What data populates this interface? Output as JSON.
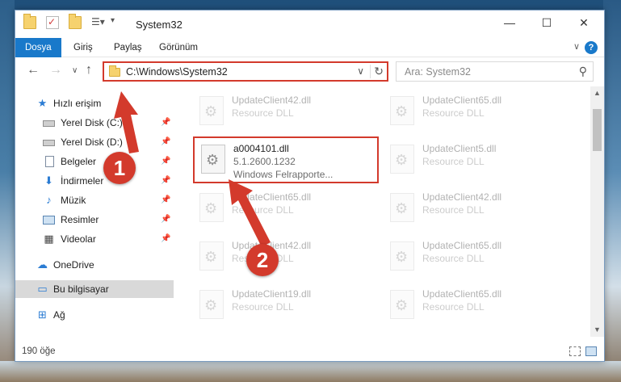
{
  "window": {
    "title": "System32",
    "controls": {
      "minimize": "—",
      "maximize": "☐",
      "close": "✕"
    }
  },
  "ribbon": {
    "tabs": [
      "Dosya",
      "Giriş",
      "Paylaş",
      "Görünüm"
    ],
    "help": "?",
    "collapse": "∨"
  },
  "nav": {
    "back": "←",
    "forward": "→",
    "recent": "∨",
    "up": "↑",
    "address": "C:\\Windows\\System32",
    "address_dropdown": "∨",
    "refresh": "↻",
    "search_placeholder": "Ara: System32",
    "search_icon": "⚲"
  },
  "sidebar": {
    "items": [
      {
        "label": "Hızlı erişim",
        "icon": "star-icon",
        "glyph": "★",
        "color": "#2b7cd3",
        "pinned": false
      },
      {
        "label": "Yerel Disk (C:)",
        "icon": "drive-icon",
        "glyph": "",
        "color": "#8f8f8f",
        "pinned": true
      },
      {
        "label": "Yerel Disk (D:)",
        "icon": "drive-icon",
        "glyph": "",
        "color": "#8f8f8f",
        "pinned": true
      },
      {
        "label": "Belgeler",
        "icon": "documents-icon",
        "glyph": "",
        "color": "#7d8ca0",
        "pinned": true
      },
      {
        "label": "İndirmeler",
        "icon": "download-icon",
        "glyph": "⬇",
        "color": "#2b7cd3",
        "pinned": true
      },
      {
        "label": "Müzik",
        "icon": "music-icon",
        "glyph": "♪",
        "color": "#2b7cd3",
        "pinned": true
      },
      {
        "label": "Resimler",
        "icon": "pictures-icon",
        "glyph": "",
        "color": "#5a86b3",
        "pinned": true
      },
      {
        "label": "Videolar",
        "icon": "videos-icon",
        "glyph": "▦",
        "color": "#444",
        "pinned": true
      },
      {
        "label": "OneDrive",
        "icon": "cloud-icon",
        "glyph": "☁",
        "color": "#2b7cd3",
        "pinned": false
      },
      {
        "label": "Bu bilgisayar",
        "icon": "computer-icon",
        "glyph": "▭",
        "color": "#2b7cd3",
        "pinned": false,
        "selected": true
      },
      {
        "label": "Ağ",
        "icon": "network-icon",
        "glyph": "⊞",
        "color": "#2b7cd3",
        "pinned": false
      }
    ],
    "pin_glyph": "📌"
  },
  "files": [
    {
      "name": "UpdateClient42.dll",
      "desc": "Resource DLL",
      "faded": true
    },
    {
      "name": "UpdateClient65.dll",
      "desc": "Resource DLL",
      "faded": true
    },
    {
      "name": "a0004101.dll",
      "version": "5.1.2600.1232",
      "desc": "Windows Felrapporte...",
      "faded": false,
      "highlight": true
    },
    {
      "name": "UpdateClient5.dll",
      "desc": "Resource DLL",
      "faded": true
    },
    {
      "name": "UpdateClient65.dll",
      "desc": "Resource DLL",
      "faded": true
    },
    {
      "name": "UpdateClient42.dll",
      "desc": "Resource DLL",
      "faded": true
    },
    {
      "name": "UpdateClient42.dll",
      "desc": "Resource DLL",
      "faded": true
    },
    {
      "name": "UpdateClient65.dll",
      "desc": "Resource DLL",
      "faded": true
    },
    {
      "name": "UpdateClient19.dll",
      "desc": "Resource DLL",
      "faded": true
    },
    {
      "name": "UpdateClient65.dll",
      "desc": "Resource DLL",
      "faded": true
    }
  ],
  "status": {
    "count": "190 öğe"
  },
  "callouts": [
    "1",
    "2"
  ],
  "colors": {
    "accent": "#1979ca",
    "annotation": "#d33a2c"
  }
}
